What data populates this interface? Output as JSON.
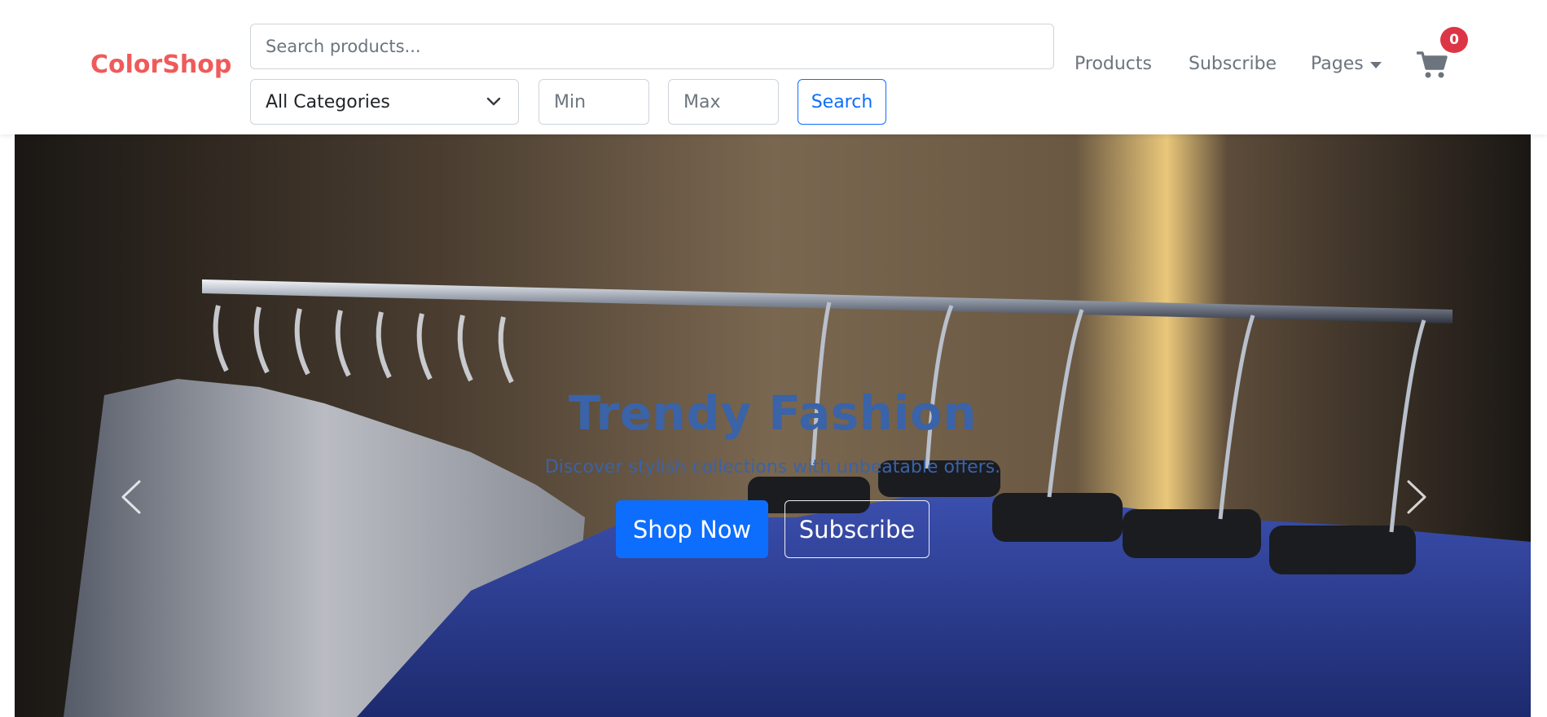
{
  "brand": "ColorShop",
  "search": {
    "placeholder": "Search products..."
  },
  "filters": {
    "category": "All Categories",
    "min_placeholder": "Min",
    "max_placeholder": "Max",
    "search_label": "Search"
  },
  "nav": {
    "products": "Products",
    "subscribe": "Subscribe",
    "pages": "Pages"
  },
  "cart": {
    "count": "0",
    "icon": "shopping-cart-icon"
  },
  "hero": {
    "title": "Trendy Fashion",
    "subtitle": "Discover stylish collections with unbeatable offers.",
    "primary_cta": "Shop Now",
    "secondary_cta": "Subscribe"
  },
  "colors": {
    "brand": "#f05a5a",
    "primary": "#0d6efd",
    "badge": "#dc3545",
    "caption": "#3a63a8"
  }
}
